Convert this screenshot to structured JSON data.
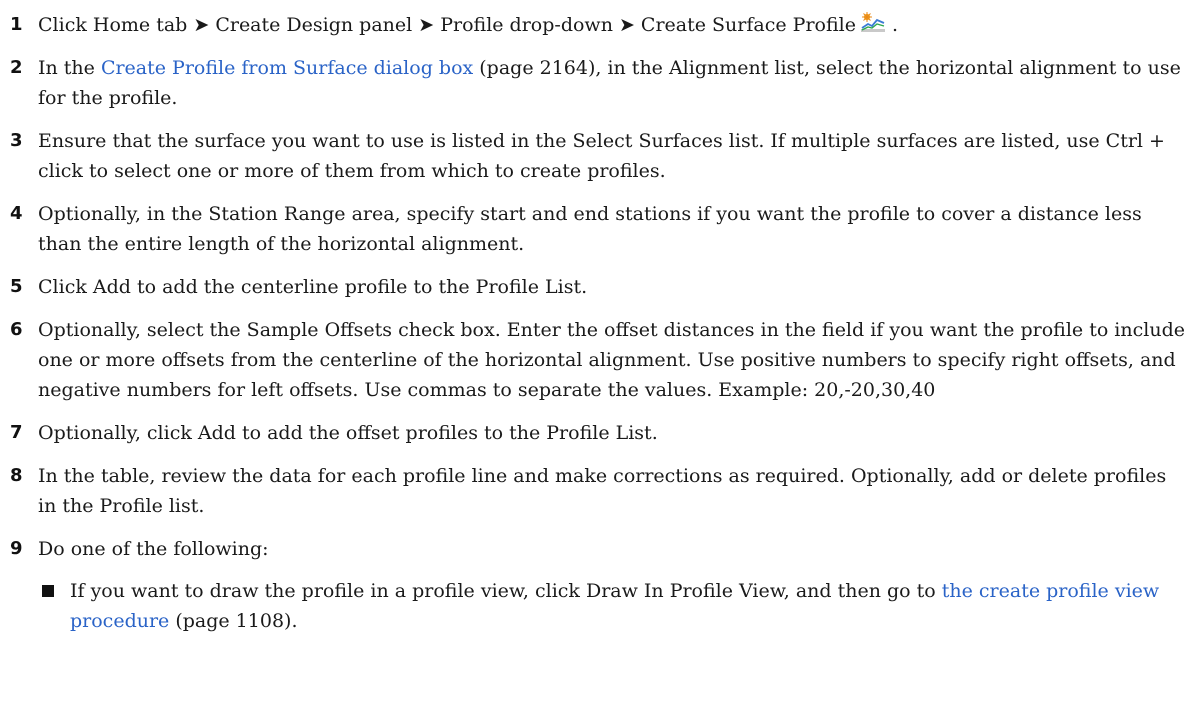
{
  "steps": [
    {
      "num": "1",
      "text": "Click Home tab ➤ Create Design panel ➤ Profile drop-down ➤ Create Surface Profile",
      "after_icon": " .",
      "icon": "create-surface-profile-icon"
    },
    {
      "num": "2",
      "before": "In the ",
      "link": "Create Profile from Surface dialog box",
      "after": " (page 2164), in the Alignment list, select the horizontal alignment to use for the profile."
    },
    {
      "num": "3",
      "text": "Ensure that the surface you want to use is listed in the Select Surfaces list. If multiple surfaces are listed, use Ctrl + click to select one or more of them from which to create profiles."
    },
    {
      "num": "4",
      "text": "Optionally, in the Station Range area, specify start and end stations if you want the profile to cover a distance less than the entire length of the horizontal alignment."
    },
    {
      "num": "5",
      "text": "Click Add to add the centerline profile to the Profile List."
    },
    {
      "num": "6",
      "text": "Optionally, select the Sample Offsets check box. Enter the offset distances in the field if you want the profile to include one or more offsets from the centerline of the horizontal alignment. Use positive numbers to specify right offsets, and negative numbers for left offsets. Use commas to separate the values. Example: 20,-20,30,40"
    },
    {
      "num": "7",
      "text": "Optionally, click Add to add the offset profiles to the Profile List."
    },
    {
      "num": "8",
      "text": "In the table, review the data for each profile line and make corrections as required. Optionally, add or delete profiles in the Profile list."
    },
    {
      "num": "9",
      "text": "Do one of the following:"
    }
  ],
  "bullets": [
    {
      "before": "If you want to draw the profile in a profile view, click Draw In Profile View, and then go to ",
      "link": "the create profile view procedure",
      "after": " (page 1108)."
    }
  ],
  "colors": {
    "link": "#2a63c7",
    "text": "#1a1a1a"
  }
}
